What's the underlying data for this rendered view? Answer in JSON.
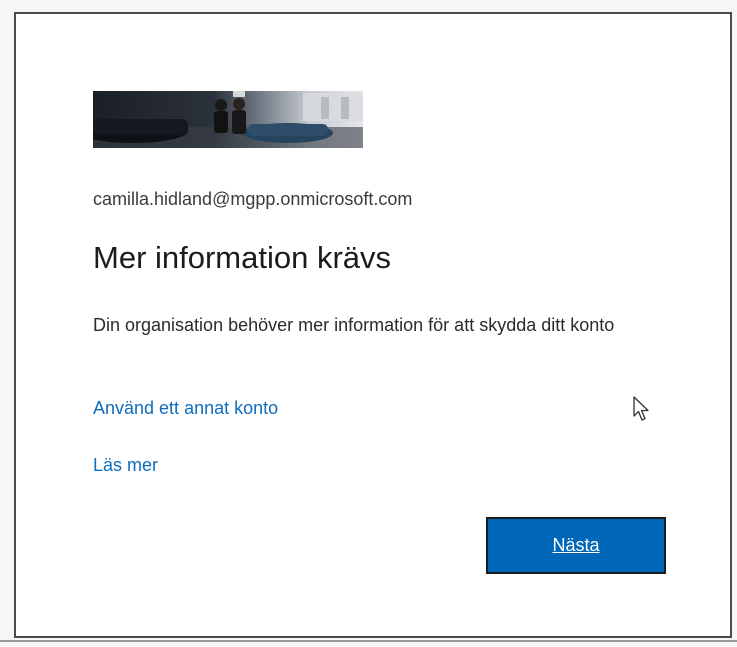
{
  "account": {
    "email": "camilla.hidland@mgpp.onmicrosoft.com"
  },
  "dialog": {
    "title": "Mer information krävs",
    "description": "Din organisation behöver mer information för att skydda ditt konto",
    "use_other_account_link": "Använd ett annat konto",
    "learn_more_link": "Läs mer",
    "next_button": "Nästa"
  },
  "colors": {
    "accent": "#0067b8",
    "link": "#0f6cbd",
    "text": "#1b1b1b"
  }
}
